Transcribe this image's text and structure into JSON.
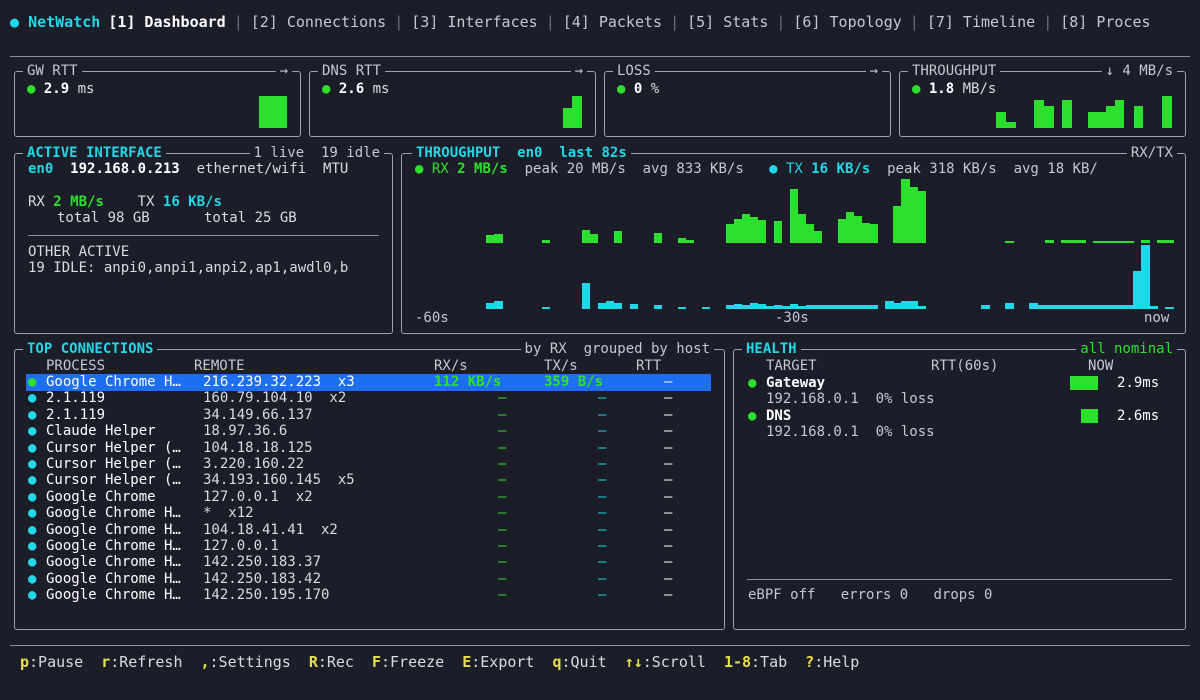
{
  "app": {
    "name": "NetWatch"
  },
  "tabs": [
    {
      "label": "[1] Dashboard",
      "active": true
    },
    {
      "label": "[2] Connections"
    },
    {
      "label": "[3] Interfaces"
    },
    {
      "label": "[4] Packets"
    },
    {
      "label": "[5] Stats"
    },
    {
      "label": "[6] Topology"
    },
    {
      "label": "[7] Timeline"
    },
    {
      "label": "[8] Proces"
    }
  ],
  "cards": {
    "gw": {
      "title": "GW RTT",
      "arrow": "→",
      "value": "2.9",
      "unit": "ms"
    },
    "dns": {
      "title": "DNS RTT",
      "arrow": "→",
      "value": "2.6",
      "unit": "ms"
    },
    "loss": {
      "title": "LOSS",
      "arrow": "→",
      "value": "0",
      "unit": "%"
    },
    "tput": {
      "title": "THROUGHPUT",
      "arrow": "↓ 4 MB/s",
      "value": "1.8",
      "unit": "MB/s"
    }
  },
  "iface": {
    "title": "ACTIVE INTERFACE",
    "status": "1 live  19 idle",
    "name": "en0",
    "ip": "192.168.0.213",
    "type": "ethernet/wifi",
    "mtu": "MTU",
    "rx_label": "RX",
    "rx_value": "2 MB/s",
    "tx_label": "TX",
    "tx_value": "16 KB/s",
    "rx_total": "total 98 GB",
    "tx_total": "total 25 GB",
    "other_label": "OTHER ACTIVE",
    "idle_line": "19 IDLE: anpi0,anpi1,anpi2,ap1,awdl0,b"
  },
  "throughput": {
    "title": "THROUGHPUT",
    "iface": "en0",
    "window": "last 82s",
    "mode": "RX/TX",
    "rx_label": "RX",
    "rx_value": "2 MB/s",
    "rx_peak": "peak 20 MB/s",
    "rx_avg": "avg 833 KB/s",
    "tx_label": "TX",
    "tx_value": "16 KB/s",
    "tx_peak": "peak 318 KB/s",
    "tx_avg": "avg 18 KB/",
    "axis_left": "-60s",
    "axis_mid": "-30s",
    "axis_right": "now",
    "rx_levels": [
      0,
      0,
      0,
      0.12,
      0.14,
      0,
      0,
      0,
      0,
      0,
      0.05,
      0,
      0,
      0,
      0,
      0.2,
      0.14,
      0,
      0,
      0.18,
      0,
      0,
      0,
      0,
      0.16,
      0,
      0,
      0.08,
      0.04,
      0,
      0,
      0,
      0,
      0.3,
      0.38,
      0.45,
      0.4,
      0.36,
      0,
      0.34,
      0,
      0.85,
      0.45,
      0.3,
      0.18,
      0,
      0,
      0.38,
      0.48,
      0.42,
      0.32,
      0.3,
      0,
      0,
      0.58,
      1.0,
      0.88,
      0.82,
      0,
      0,
      0,
      0,
      0,
      0,
      0,
      0,
      0,
      0,
      0.02,
      0,
      0,
      0,
      0,
      0.05,
      0,
      0.05,
      0.05,
      0.05,
      0,
      0.02,
      0.02,
      0.02,
      0.02,
      0.02,
      0,
      0.05,
      0,
      0.05,
      0.05
    ],
    "tx_levels": [
      0,
      0,
      0,
      0.1,
      0.13,
      0,
      0,
      0,
      0,
      0,
      0.02,
      0,
      0,
      0,
      0,
      0.4,
      0,
      0.1,
      0.13,
      0.1,
      0,
      0.08,
      0,
      0,
      0.07,
      0,
      0,
      0.02,
      0,
      0,
      0.02,
      0,
      0,
      0.06,
      0.08,
      0.06,
      0.1,
      0.08,
      0.04,
      0.06,
      0.04,
      0.08,
      0.04,
      0.06,
      0.06,
      0.06,
      0.06,
      0.06,
      0.06,
      0.06,
      0.06,
      0.06,
      0,
      0.13,
      0.09,
      0.13,
      0.13,
      0.04,
      0,
      0,
      0,
      0,
      0,
      0,
      0,
      0.06,
      0,
      0,
      0.09,
      0,
      0,
      0.09,
      0.06,
      0.07,
      0.06,
      0.06,
      0.06,
      0.06,
      0.06,
      0.06,
      0.06,
      0.06,
      0.06,
      0.06,
      0.6,
      1.0,
      0.05,
      0,
      0.02
    ]
  },
  "connections": {
    "title": "TOP CONNECTIONS",
    "sort": "by RX",
    "group": "grouped by host",
    "headers": {
      "process": "PROCESS",
      "remote": "REMOTE",
      "rx": "RX/s",
      "tx": "TX/s",
      "rtt": "RTT"
    },
    "rows": [
      {
        "process": "Google Chrome H…",
        "remote": "216.239.32.223  x3",
        "rx": "112 KB/s",
        "tx": "359 B/s",
        "rtt": "—",
        "dot": "green",
        "selected": true
      },
      {
        "process": "2.1.119",
        "remote": "160.79.104.10  x2",
        "rx": "—",
        "tx": "—",
        "rtt": "—",
        "dot": "cyan"
      },
      {
        "process": "2.1.119",
        "remote": "34.149.66.137",
        "rx": "—",
        "tx": "—",
        "rtt": "—",
        "dot": "cyan"
      },
      {
        "process": "Claude Helper",
        "remote": "18.97.36.6",
        "rx": "—",
        "tx": "—",
        "rtt": "—",
        "dot": "cyan"
      },
      {
        "process": "Cursor Helper (…",
        "remote": "104.18.18.125",
        "rx": "—",
        "tx": "—",
        "rtt": "—",
        "dot": "cyan"
      },
      {
        "process": "Cursor Helper (…",
        "remote": "3.220.160.22",
        "rx": "—",
        "tx": "—",
        "rtt": "—",
        "dot": "cyan"
      },
      {
        "process": "Cursor Helper (…",
        "remote": "34.193.160.145  x5",
        "rx": "—",
        "tx": "—",
        "rtt": "—",
        "dot": "cyan"
      },
      {
        "process": "Google Chrome",
        "remote": "127.0.0.1  x2",
        "rx": "—",
        "tx": "—",
        "rtt": "—",
        "dot": "cyan"
      },
      {
        "process": "Google Chrome H…",
        "remote": "*  x12",
        "rx": "—",
        "tx": "—",
        "rtt": "—",
        "dot": "cyan"
      },
      {
        "process": "Google Chrome H…",
        "remote": "104.18.41.41  x2",
        "rx": "—",
        "tx": "—",
        "rtt": "—",
        "dot": "cyan"
      },
      {
        "process": "Google Chrome H…",
        "remote": "127.0.0.1",
        "rx": "—",
        "tx": "—",
        "rtt": "—",
        "dot": "cyan"
      },
      {
        "process": "Google Chrome H…",
        "remote": "142.250.183.37",
        "rx": "—",
        "tx": "—",
        "rtt": "—",
        "dot": "cyan"
      },
      {
        "process": "Google Chrome H…",
        "remote": "142.250.183.42",
        "rx": "—",
        "tx": "—",
        "rtt": "—",
        "dot": "cyan"
      },
      {
        "process": "Google Chrome H…",
        "remote": "142.250.195.170",
        "rx": "—",
        "tx": "—",
        "rtt": "—",
        "dot": "cyan"
      }
    ]
  },
  "health": {
    "title": "HEALTH",
    "status": "all nominal",
    "headers": {
      "target": "TARGET",
      "rtt": "RTT(60s)",
      "now": "NOW"
    },
    "targets": [
      {
        "name": "Gateway",
        "detail": "192.168.0.1  0% loss",
        "now": "2.9ms",
        "level": 1.0
      },
      {
        "name": "DNS",
        "detail": "192.168.0.1  0% loss",
        "now": "2.6ms",
        "level": 0.6
      }
    ],
    "footer": {
      "ebpf": "eBPF off",
      "errors": "errors 0",
      "drops": "drops 0"
    }
  },
  "footer_keys": [
    {
      "key": "p",
      "desc": ":Pause"
    },
    {
      "key": "r",
      "desc": ":Refresh"
    },
    {
      "key": ",",
      "desc": ":Settings"
    },
    {
      "key": "R",
      "desc": ":Rec"
    },
    {
      "key": "F",
      "desc": ":Freeze"
    },
    {
      "key": "E",
      "desc": ":Export"
    },
    {
      "key": "q",
      "desc": ":Quit"
    },
    {
      "key": "↑↓",
      "desc": ":Scroll"
    },
    {
      "key": "1-8",
      "desc": ":Tab"
    },
    {
      "key": "?",
      "desc": ":Help"
    }
  ]
}
